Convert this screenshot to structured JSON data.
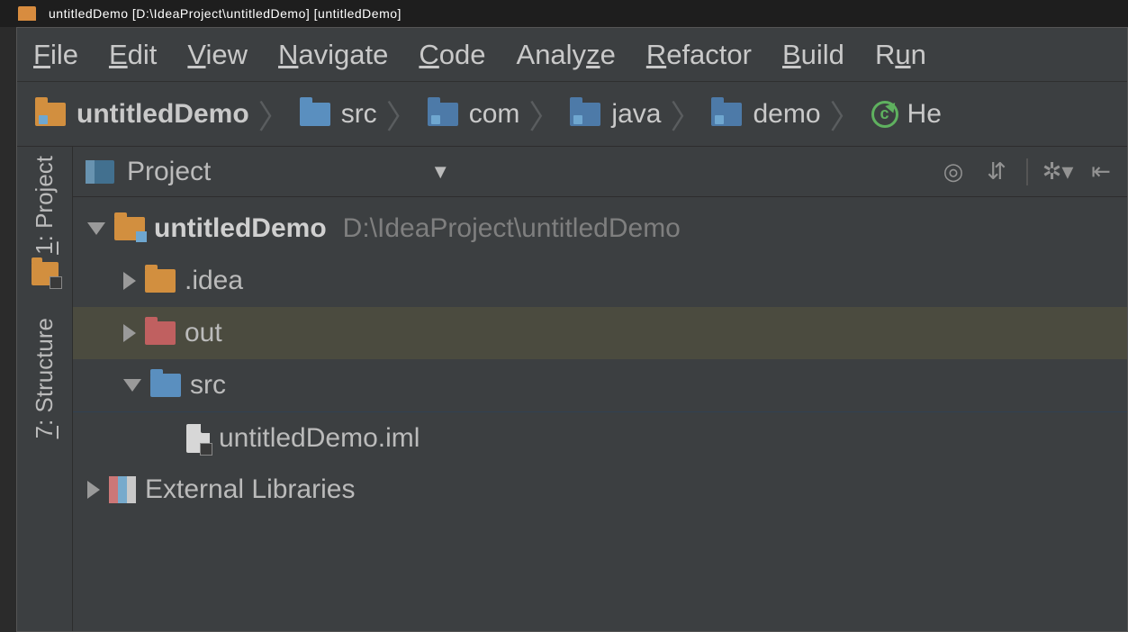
{
  "titlebar": {
    "text": "untitledDemo   [D:\\IdeaProject\\untitledDemo]   [untitledDemo]"
  },
  "menu": {
    "items": [
      {
        "m": "F",
        "rest": "ile"
      },
      {
        "m": "E",
        "rest": "dit"
      },
      {
        "m": "V",
        "rest": "iew"
      },
      {
        "m": "N",
        "rest": "avigate"
      },
      {
        "m": "C",
        "rest": "ode"
      },
      {
        "m": "",
        "rest": "Analy",
        "m2": "z",
        "rest2": "e"
      },
      {
        "m": "R",
        "rest": "efactor"
      },
      {
        "m": "B",
        "rest": "uild"
      },
      {
        "m": "",
        "rest": "R",
        "m2": "u",
        "rest2": "n"
      }
    ]
  },
  "breadcrumbs": [
    {
      "icon": "folder-yellow",
      "label": "untitledDemo",
      "bold": true
    },
    {
      "icon": "folder-blue",
      "label": "src"
    },
    {
      "icon": "folder-darkblue",
      "label": "com"
    },
    {
      "icon": "folder-darkblue",
      "label": "java"
    },
    {
      "icon": "folder-darkblue",
      "label": "demo"
    },
    {
      "icon": "class",
      "label": "He"
    }
  ],
  "left_strip": {
    "project": {
      "num": "1",
      "label": "Project"
    },
    "structure": {
      "num": "7",
      "label": "Structure"
    }
  },
  "tool_header": {
    "title": "Project",
    "dropdown": "▼"
  },
  "tree": {
    "root": {
      "name": "untitledDemo",
      "path": "D:\\IdeaProject\\untitledDemo"
    },
    "idea": ".idea",
    "out": "out",
    "src": "src",
    "iml": "untitledDemo.iml",
    "ext": "External Libraries"
  }
}
